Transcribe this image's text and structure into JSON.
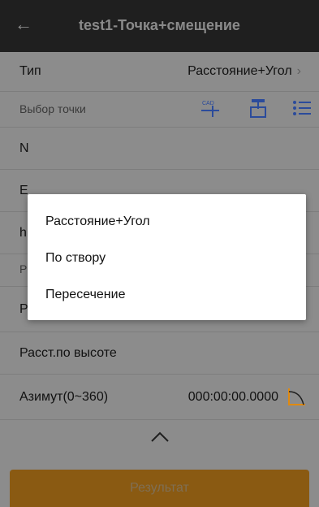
{
  "header": {
    "title": "test1-Точка+смещение",
    "back_icon": "arrow-left-icon"
  },
  "form": {
    "type_label": "Тип",
    "type_value": "Расстояние+Угол",
    "point_select_label": "Выбор точки",
    "n_label": "N",
    "e_label": "E",
    "h_label": "h",
    "p_label_small": "Р",
    "p_label": "Р",
    "height_dist_label": "Расст.по высоте",
    "azimuth_label": "Азимут(0~360)",
    "azimuth_value": "000:00:00.0000"
  },
  "toolbar_icons": [
    "cad-pick-icon",
    "survey-point-icon",
    "list-icon"
  ],
  "dialog": {
    "options": [
      "Расстояние+Угол",
      "По створу",
      "Пересечение"
    ]
  },
  "footer": {
    "result_label": "Результат"
  },
  "colors": {
    "accent": "#e08a10",
    "header_bg": "#1f1f1f",
    "icon_blue": "#2b4b9b"
  }
}
